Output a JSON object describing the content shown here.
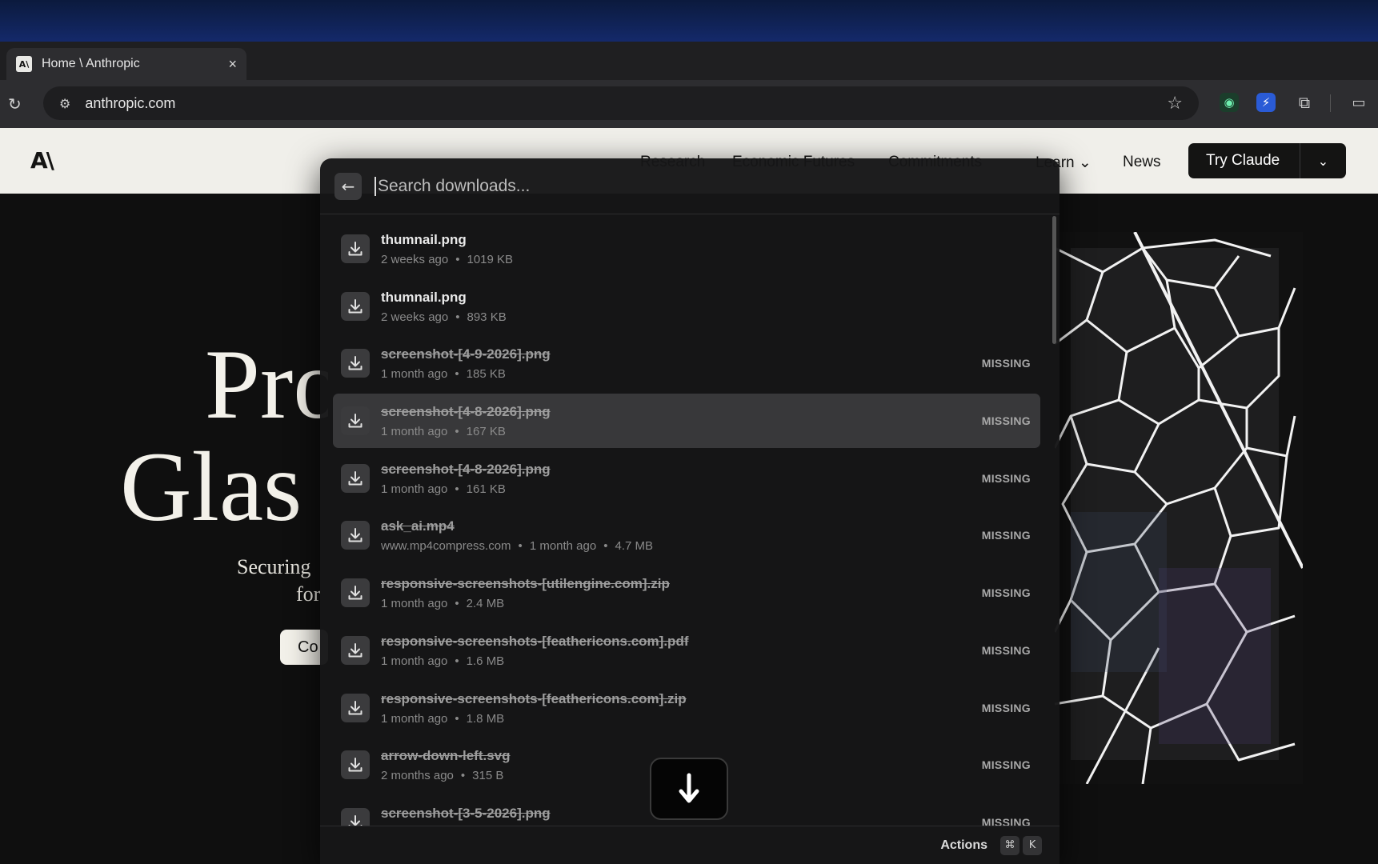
{
  "browser": {
    "tab": {
      "favicon": "A\\",
      "title": "Home \\ Anthropic",
      "close": "×"
    },
    "new_tab": "+",
    "url": "anthropic.com",
    "icons": [
      "reload-icon",
      "tune-icon",
      "star-icon",
      "extension-green-icon",
      "extension-blue-icon",
      "puzzle-icon",
      "sidepanel-icon"
    ]
  },
  "site": {
    "logo": "A\\",
    "nav": {
      "research": "Research",
      "economic": "Economic Futures",
      "commitments": "Commitments",
      "learn": "Learn",
      "news": "News"
    },
    "try_claude": "Try Claude",
    "hero": {
      "line1": "Pro",
      "line2": "Glas",
      "sub1": "Securing",
      "sub2": "for",
      "button": "Co"
    }
  },
  "downloads": {
    "search_placeholder": "Search downloads...",
    "missing_label": "MISSING",
    "items": [
      {
        "name": "thumnail.png",
        "when": "2 weeks ago",
        "size": "1019 KB",
        "missing": false
      },
      {
        "name": "thumnail.png",
        "when": "2 weeks ago",
        "size": "893 KB",
        "missing": false
      },
      {
        "name": "screenshot-[4-9-2026].png",
        "when": "1 month ago",
        "size": "185 KB",
        "missing": true
      },
      {
        "name": "screenshot-[4-8-2026].png",
        "when": "1 month ago",
        "size": "167 KB",
        "missing": true
      },
      {
        "name": "screenshot-[4-8-2026].png",
        "when": "1 month ago",
        "size": "161 KB",
        "missing": true
      },
      {
        "name": "ask_ai.mp4",
        "source": "www.mp4compress.com",
        "when": "1 month ago",
        "size": "4.7 MB",
        "missing": true
      },
      {
        "name": "responsive-screenshots-[utilengine.com].zip",
        "when": "1 month ago",
        "size": "2.4 MB",
        "missing": true
      },
      {
        "name": "responsive-screenshots-[feathericons.com].pdf",
        "when": "1 month ago",
        "size": "1.6 MB",
        "missing": true
      },
      {
        "name": "responsive-screenshots-[feathericons.com].zip",
        "when": "1 month ago",
        "size": "1.8 MB",
        "missing": true
      },
      {
        "name": "arrow-down-left.svg",
        "when": "2 months ago",
        "size": "315 B",
        "missing": true
      },
      {
        "name": "screenshot-[3-5-2026].png",
        "when": "",
        "size": "",
        "missing": true
      }
    ],
    "selected_index": 3,
    "footer": {
      "actions": "Actions",
      "key1": "⌘",
      "key2": "K"
    }
  }
}
